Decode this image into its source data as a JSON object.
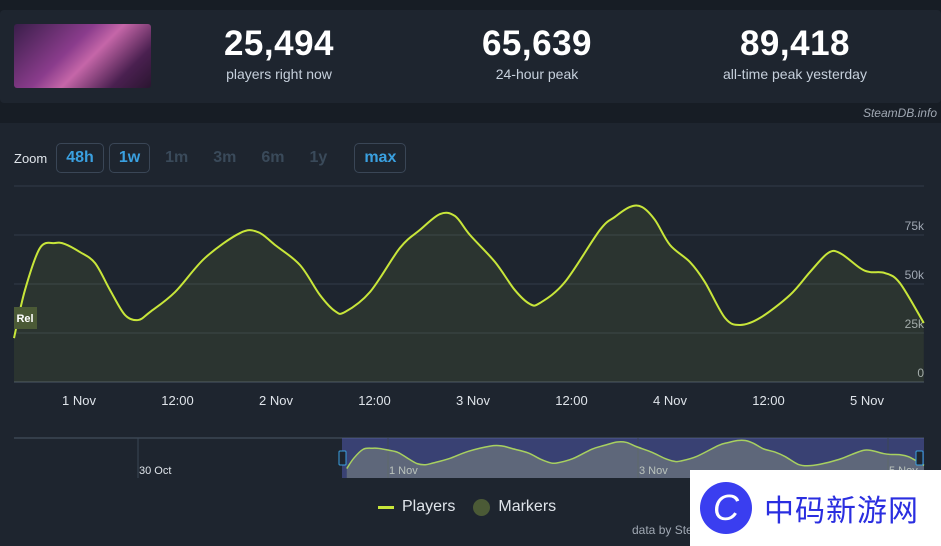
{
  "header": {
    "stats": [
      {
        "value": "25,494",
        "label": "players right now"
      },
      {
        "value": "65,639",
        "label": "24-hour peak"
      },
      {
        "value": "89,418",
        "label": "all-time peak yesterday"
      }
    ],
    "credit": "SteamDB.info"
  },
  "zoom": {
    "label": "Zoom",
    "buttons": [
      {
        "label": "48h",
        "active": true
      },
      {
        "label": "1w",
        "active": true
      },
      {
        "label": "1m",
        "active": false
      },
      {
        "label": "3m",
        "active": false
      },
      {
        "label": "6m",
        "active": false
      },
      {
        "label": "1y",
        "active": false
      },
      {
        "label": "max",
        "active": true
      }
    ]
  },
  "chart_data": {
    "type": "line",
    "series": [
      {
        "name": "Players",
        "color": "#c8e63a",
        "points": [
          [
            "31 Oct 16:05",
            22400
          ],
          [
            "31 Oct 17:25",
            46900
          ],
          [
            "31 Oct 19:15",
            68400
          ],
          [
            "31 Oct 21:05",
            70900
          ],
          [
            "31 Oct 22:17",
            70400
          ],
          [
            "1 Nov 00:07",
            66300
          ],
          [
            "1 Nov 01:57",
            60700
          ],
          [
            "1 Nov 03:47",
            46900
          ],
          [
            "1 Nov 05:36",
            34200
          ],
          [
            "1 Nov 07:11",
            31600
          ],
          [
            "1 Nov 08:39",
            35700
          ],
          [
            "1 Nov 11:42",
            45900
          ],
          [
            "1 Nov 15:21",
            63300
          ],
          [
            "1 Nov 19:37",
            76000
          ],
          [
            "1 Nov 21:48",
            76500
          ],
          [
            "1 Nov 23:53",
            69900
          ],
          [
            "2 Nov 02:55",
            59700
          ],
          [
            "2 Nov 05:21",
            44400
          ],
          [
            "2 Nov 07:11",
            36200
          ],
          [
            "2 Nov 08:24",
            35700
          ],
          [
            "2 Nov 11:27",
            45900
          ],
          [
            "2 Nov 15:06",
            68400
          ],
          [
            "2 Nov 17:32",
            77600
          ],
          [
            "2 Nov 19:59",
            85700
          ],
          [
            "2 Nov 21:48",
            84700
          ],
          [
            "2 Nov 23:38",
            75000
          ],
          [
            "3 Nov 02:41",
            61200
          ],
          [
            "3 Nov 05:06",
            46900
          ],
          [
            "3 Nov 06:56",
            39800
          ],
          [
            "3 Nov 08:09",
            40300
          ],
          [
            "3 Nov 11:12",
            51000
          ],
          [
            "3 Nov 15:28",
            77600
          ],
          [
            "3 Nov 17:17",
            84200
          ],
          [
            "3 Nov 19:07",
            89300
          ],
          [
            "3 Nov 20:35",
            89300
          ],
          [
            "3 Nov 22:10",
            82700
          ],
          [
            "4 Nov 00:00",
            69900
          ],
          [
            "4 Nov 02:26",
            61200
          ],
          [
            "4 Nov 04:15",
            51000
          ],
          [
            "4 Nov 06:42",
            32700
          ],
          [
            "4 Nov 08:32",
            29100
          ],
          [
            "4 Nov 10:58",
            32700
          ],
          [
            "4 Nov 14:37",
            44400
          ],
          [
            "4 Nov 17:03",
            56100
          ],
          [
            "4 Nov 19:15",
            65800
          ],
          [
            "4 Nov 20:42",
            65800
          ],
          [
            "4 Nov 23:08",
            58200
          ],
          [
            "5 Nov 00:22",
            56100
          ],
          [
            "5 Nov 02:11",
            55600
          ],
          [
            "5 Nov 04:00",
            50500
          ],
          [
            "5 Nov 06:55",
            30100
          ]
        ]
      }
    ],
    "x_ticks": [
      "1 Nov",
      "12:00",
      "2 Nov",
      "12:00",
      "3 Nov",
      "12:00",
      "4 Nov",
      "12:00",
      "5 Nov"
    ],
    "y_ticks": [
      "0",
      "25k",
      "50k",
      "75k"
    ],
    "ylim": [
      0,
      100000
    ],
    "grid": true,
    "marker_label": "Rel",
    "navigator_ticks": [
      "30 Oct",
      "1 Nov",
      "3 Nov",
      "5 Nov"
    ]
  },
  "legend": {
    "players": "Players",
    "markers": "Markers"
  },
  "footer": {
    "data_by": "data by Ste"
  },
  "watermark": {
    "text": "中码新游网",
    "glyph": "C"
  }
}
